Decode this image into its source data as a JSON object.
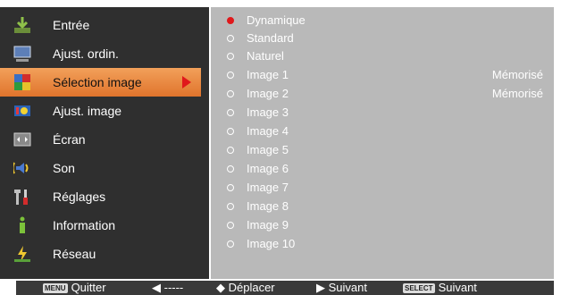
{
  "menu": {
    "items": [
      {
        "label": "Entrée",
        "icon": "input-icon"
      },
      {
        "label": "Ajust. ordin.",
        "icon": "computer-adjust-icon"
      },
      {
        "label": "Sélection image",
        "icon": "image-select-icon",
        "selected": true
      },
      {
        "label": "Ajust. image",
        "icon": "image-adjust-icon"
      },
      {
        "label": "Écran",
        "icon": "screen-icon"
      },
      {
        "label": "Son",
        "icon": "sound-icon"
      },
      {
        "label": "Réglages",
        "icon": "settings-tools-icon"
      },
      {
        "label": "Information",
        "icon": "information-icon"
      },
      {
        "label": "Réseau",
        "icon": "network-icon"
      }
    ]
  },
  "options": {
    "items": [
      {
        "label": "Dynamique",
        "selected": true,
        "status": ""
      },
      {
        "label": "Standard",
        "status": ""
      },
      {
        "label": "Naturel",
        "status": ""
      },
      {
        "label": "Image 1",
        "status": "Mémorisé"
      },
      {
        "label": "Image 2",
        "status": "Mémorisé"
      },
      {
        "label": "Image 3",
        "status": ""
      },
      {
        "label": "Image 4",
        "status": ""
      },
      {
        "label": "Image 5",
        "status": ""
      },
      {
        "label": "Image 6",
        "status": ""
      },
      {
        "label": "Image 7",
        "status": ""
      },
      {
        "label": "Image 8",
        "status": ""
      },
      {
        "label": "Image 9",
        "status": ""
      },
      {
        "label": "Image 10",
        "status": ""
      }
    ]
  },
  "footer": {
    "quit_key": "MENU",
    "quit_label": "Quitter",
    "back_label": "-----",
    "move_label": "Déplacer",
    "next_label": "Suivant",
    "select_key": "SELECT",
    "select_label": "Suivant"
  },
  "colors": {
    "menu_bg": "#2f2f2f",
    "options_bg": "#b9b9b9",
    "selected_bg": "#e88a40",
    "radio_on": "#e0181b"
  }
}
